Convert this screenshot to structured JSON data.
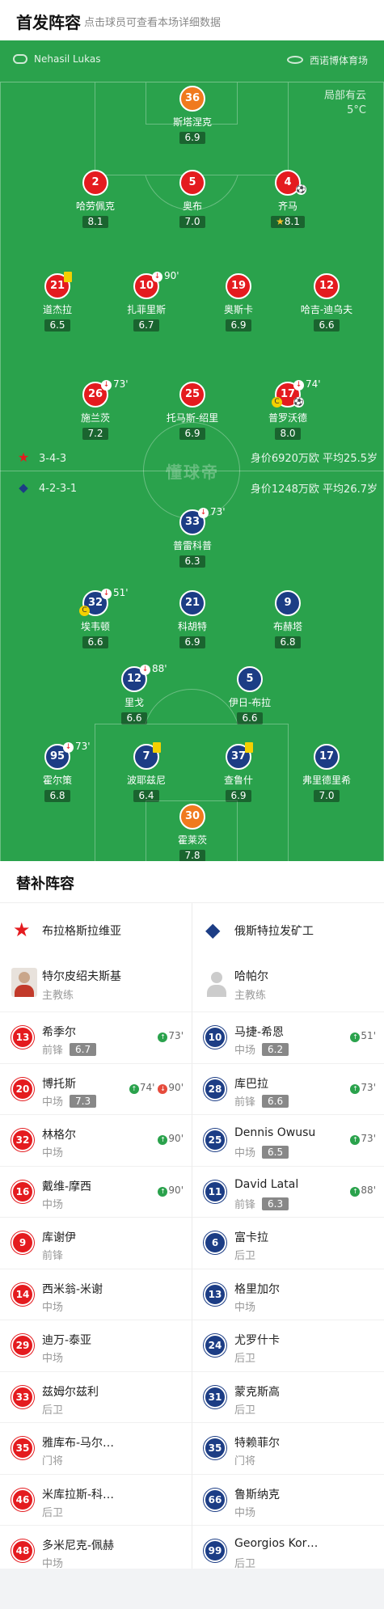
{
  "header": {
    "title": "首发阵容",
    "subtitle": "点击球员可查看本场详细数据"
  },
  "pitch": {
    "referee": "Nehasil Lukas",
    "venue": "西诺博体育场",
    "weather": "局部有云",
    "temperature": "5°C",
    "watermark": "懂球帝",
    "home_formation": "3-4-3",
    "home_meta": "身价6920万欧 平均25.5岁",
    "away_formation": "4-2-3-1",
    "away_meta": "身价1248万欧 平均26.7岁"
  },
  "colors": {
    "pitch": "#2aa24c",
    "home": "#e41b1f",
    "away": "#1c3d85",
    "keeper": "#f07a1e"
  },
  "home_players": [
    {
      "num": "36",
      "name": "斯塔涅克",
      "rating": "6.9"
    },
    {
      "num": "2",
      "name": "哈劳佩克",
      "rating": "8.1"
    },
    {
      "num": "5",
      "name": "奥布",
      "rating": "7.0"
    },
    {
      "num": "4",
      "name": "齐马",
      "rating": "8.1"
    },
    {
      "num": "21",
      "name": "道杰拉",
      "rating": "6.5"
    },
    {
      "num": "10",
      "name": "扎菲里斯",
      "rating": "6.7",
      "event": "90'"
    },
    {
      "num": "19",
      "name": "奥斯卡",
      "rating": "6.9"
    },
    {
      "num": "12",
      "name": "哈吉-迪乌夫",
      "rating": "6.6"
    },
    {
      "num": "26",
      "name": "施兰茨",
      "rating": "7.2",
      "event": "73'"
    },
    {
      "num": "25",
      "name": "托马斯-绍里",
      "rating": "6.9"
    },
    {
      "num": "17",
      "name": "普罗沃德",
      "rating": "8.0",
      "event": "74'"
    }
  ],
  "away_players": [
    {
      "num": "33",
      "name": "普雷科普",
      "rating": "6.3",
      "event": "73'"
    },
    {
      "num": "32",
      "name": "埃韦顿",
      "rating": "6.6",
      "event": "51'"
    },
    {
      "num": "21",
      "name": "科胡特",
      "rating": "6.9"
    },
    {
      "num": "9",
      "name": "布赫塔",
      "rating": "6.8"
    },
    {
      "num": "12",
      "name": "里戈",
      "rating": "6.6",
      "event": "88'"
    },
    {
      "num": "5",
      "name": "伊日-布拉",
      "rating": "6.6"
    },
    {
      "num": "95",
      "name": "霍尔策",
      "rating": "6.8",
      "event": "73'"
    },
    {
      "num": "7",
      "name": "波耶兹尼",
      "rating": "6.4"
    },
    {
      "num": "37",
      "name": "查鲁什",
      "rating": "6.9"
    },
    {
      "num": "17",
      "name": "弗里德里希",
      "rating": "7.0"
    },
    {
      "num": "30",
      "name": "霍莱茨",
      "rating": "7.8"
    }
  ],
  "bench": {
    "title": "替补阵容",
    "home": {
      "team": "布拉格斯拉维亚",
      "coach": "特尔皮绍夫斯基",
      "coach_role": "主教练",
      "subs": [
        {
          "num": "13",
          "name": "希季尔",
          "pos": "前锋",
          "rating": "6.7",
          "in": "73'"
        },
        {
          "num": "20",
          "name": "博托斯",
          "pos": "中场",
          "rating": "7.3",
          "in": "74'",
          "out": "90'"
        },
        {
          "num": "32",
          "name": "林格尔",
          "pos": "中场",
          "in": "90'"
        },
        {
          "num": "16",
          "name": "戴维-摩西",
          "pos": "中场",
          "in": "90'"
        },
        {
          "num": "9",
          "name": "库谢伊",
          "pos": "前锋"
        },
        {
          "num": "14",
          "name": "西米翁-米谢",
          "pos": "中场"
        },
        {
          "num": "29",
          "name": "迪万-泰亚",
          "pos": "中场"
        },
        {
          "num": "33",
          "name": "兹姆尔兹利",
          "pos": "后卫"
        },
        {
          "num": "35",
          "name": "雅库布-马尔…",
          "pos": "门将"
        },
        {
          "num": "46",
          "name": "米库拉斯-科…",
          "pos": "后卫"
        },
        {
          "num": "48",
          "name": "多米尼克-佩赫",
          "pos": "中场"
        }
      ]
    },
    "away": {
      "team": "俄斯特拉发矿工",
      "coach": "哈帕尔",
      "coach_role": "主教练",
      "subs": [
        {
          "num": "10",
          "name": "马捷-希恩",
          "pos": "中场",
          "rating": "6.2",
          "in": "51'"
        },
        {
          "num": "28",
          "name": "库巴拉",
          "pos": "前锋",
          "rating": "6.6",
          "in": "73'"
        },
        {
          "num": "25",
          "name": "Dennis Owusu",
          "pos": "中场",
          "rating": "6.5",
          "in": "73'"
        },
        {
          "num": "11",
          "name": "David Latal",
          "pos": "前锋",
          "rating": "6.3",
          "in": "88'"
        },
        {
          "num": "6",
          "name": "富卡拉",
          "pos": "后卫"
        },
        {
          "num": "13",
          "name": "格里加尔",
          "pos": "中场"
        },
        {
          "num": "24",
          "name": "尤罗什卡",
          "pos": "后卫"
        },
        {
          "num": "31",
          "name": "蒙克斯高",
          "pos": "后卫"
        },
        {
          "num": "35",
          "name": "特赖菲尔",
          "pos": "门将"
        },
        {
          "num": "66",
          "name": "鲁斯纳克",
          "pos": "中场"
        },
        {
          "num": "99",
          "name": "Georgios Kor…",
          "pos": "后卫"
        }
      ]
    }
  }
}
